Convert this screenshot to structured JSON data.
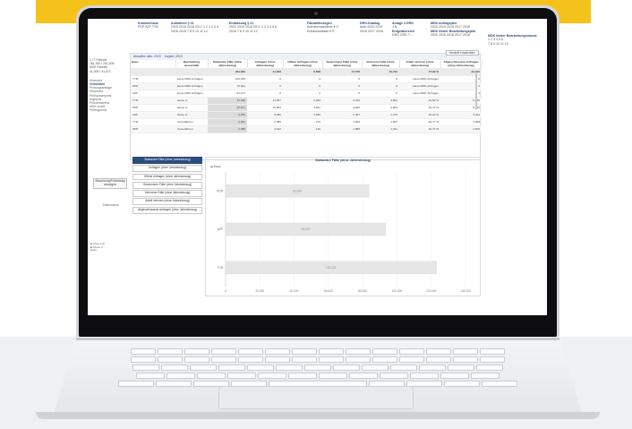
{
  "filters": {
    "krankenhaus": {
      "title": "Krankenhaus",
      "values": "PDP   AZF   TYB"
    },
    "aufnahme": {
      "title": "Aufnahme § 21",
      "row1": "2020  2019  2018  2017   1   2   3   4   5   6",
      "row2": "2016  2015                 7   8   9  10  11  12"
    },
    "entlassung": {
      "title": "Entlassung § 21",
      "row1": "2020  2019  2018  2017   1   2   3   4   5   6",
      "row2": "2016                       7   8   9  10  11  12"
    },
    "fallzahl": {
      "title": "Fallzahlbezogen",
      "row1": "Aufnahmeanlässe  ▾   9",
      "row2": "Entlassanlässe  ▾   9"
    },
    "drg": {
      "title": "DRG-Katalog",
      "row1": "Auth  2020  2019",
      "row2": "2018  2017  2016"
    },
    "anlage": {
      "title": "Anlage 3 DRG",
      "row1": "J        N",
      "row2": "Entgeltbereich",
      "row3": "DRG    DRG T..."
    },
    "mdk_anfrage": {
      "title": "MDK Anfragejahr",
      "row1": "2020  2019  2018  2017  2016"
    },
    "mdk_letzte": {
      "title": "MDK letzter Bearbeitungsjahr",
      "row1": "2020  2019  2018  2017  2016"
    },
    "mdk_monat": {
      "title": "MDK letzter Bearbeitungsmonat",
      "row1": "1    2    3    4    5    6",
      "row2": "7    8    9   10   11  12"
    }
  },
  "left": {
    "kpi1": "1,77 Fallzahl",
    "kpi2": "261,300 / 261,305",
    "kpi3": "MDK Fallzahl",
    "kpi4": "41,009 / 41,474",
    "menu": [
      "Übersicht",
      "Verteilaten",
      "Prüfungsanfrage",
      "Rückerlös",
      "Prüfschwerpunk",
      "Ergebnis",
      "Prüfverfahrens",
      "MDK-Anteil",
      "Prüfergebnis"
    ],
    "active_index": 1
  },
  "table": {
    "tab1": "Aktuelles Jahr: 2020",
    "tab2": "Vorjahr: 2019",
    "export": "Herstellt erfolderlider",
    "headers": [
      "Haus",
      "Bearbeitung ausserhalb",
      "Stationäre Fälle (ohne Jahresbezug)",
      "Anfragen (ohne Jahresbezug)",
      "Offene Anfragen (ohne Jahresbezug)",
      "Gewonnene Fälle (ohne Jahresbezug)",
      "Verlorene Fälle (ohne Jahresbezug)",
      "Anteil verloren (ohne Jahresbezug)",
      "Abgeschlossene Anfragen (ohne Jahresbezug)"
    ],
    "total": [
      "",
      "",
      "261,300",
      "41,009",
      "8,588",
      "17,578",
      "15,742",
      "47,29 %",
      "32,310"
    ],
    "rows": [
      [
        "TYB",
        "keine MDK-Anfragen",
        "109,425",
        "0",
        "0",
        "0",
        "0",
        "keine MDK-Anfragen",
        "0"
      ],
      [
        "PDP",
        "keine MDK-Anfragen",
        "70,641",
        "0",
        "0",
        "0",
        "0",
        "keine MDK-Anfragen",
        "0"
      ],
      [
        "AZF",
        "keine MDK-Anfragen",
        "81,177",
        "0",
        "0",
        "0",
        "0",
        "keine MDK-Anfragen",
        "0"
      ],
      [
        "TYB",
        "kasse xt",
        "11,340",
        "11,557",
        "2,294",
        "4,700",
        "4,563",
        "46,52 %",
        "9,265"
      ],
      [
        "PDP",
        "kasse xt",
        "10,671",
        "10,603",
        "2,811",
        "4,620",
        "4,602",
        "49,72 %",
        "8,462"
      ],
      [
        "AZF",
        "kasse xt",
        "9,294",
        "9,286",
        "1,655",
        "2,307",
        "2,279",
        "49,22 %",
        "6,611"
      ],
      [
        "TYB",
        "Versetfahren",
        "2,361",
        "2,385",
        "270",
        "1,603",
        "1,567",
        "49,77 %",
        "3,008"
      ],
      [
        "PDP",
        "Versetfahren",
        "2,388",
        "3,612",
        "149",
        "1,868",
        "1,511",
        "49,72 %",
        "2,870"
      ]
    ]
  },
  "side": {
    "btn1": "Bewertung/Prüfantrag anzeigen",
    "label": "Datenstand",
    "legend1": "■ Ohne 1-Ø",
    "legend2": "■ Kasse xt",
    "legend3": "Reko..."
  },
  "measures": {
    "items": [
      "Stationäre Fälle (ohne Jahresbezug)",
      "Anfragen (ohne Jahresbezug)",
      "Offene Anfragen (ohne Jahresbezug)",
      "Gewonnene Fälle (ohne Jahresbezug)",
      "Verlorene Fälle (ohne Jahresbezug)",
      "Anteil verloren (ohne Jahresbezug)",
      "Abgeschlossene Anfragen (ohne Jahresbezug)"
    ],
    "selected": 0
  },
  "chart_data": {
    "type": "bar",
    "orientation": "horizontal",
    "title": "Stationäre Fälle (ohne Jahresbezug)",
    "filter_label": "Haus",
    "categories": [
      "PDP",
      "AZF",
      "TYB"
    ],
    "values": [
      83700,
      93500,
      123100
    ],
    "data_labels": [
      "83,700",
      "93,472",
      "123,131"
    ],
    "xlim": [
      0,
      140000
    ],
    "xticks": [
      "0",
      "20,000",
      "40,000",
      "60,000",
      "80,000",
      "100,000",
      "120,000",
      "140,000"
    ],
    "bar_color": "#e6e6e6"
  }
}
